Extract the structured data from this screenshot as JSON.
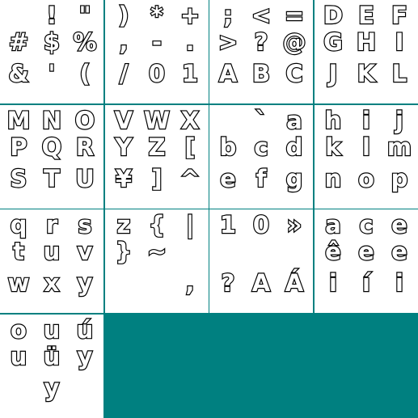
{
  "background_color": "#008080",
  "tile_color": "#ffffff",
  "glyph_fill": "#ffffff",
  "glyph_outline": "#000000",
  "tiles": [
    {
      "glyphs": [
        "!",
        "\"",
        "#",
        "$",
        "%",
        "&",
        "'",
        "("
      ]
    },
    {
      "glyphs": [
        ")",
        "*",
        "+",
        ",",
        "-",
        ".",
        "/",
        "0",
        "1"
      ]
    },
    {
      "glyphs": [
        ";",
        "<",
        "=",
        ">",
        "?",
        "@",
        "A",
        "B",
        "C"
      ]
    },
    {
      "glyphs": [
        "D",
        "E",
        "F",
        "G",
        "H",
        "I",
        "J",
        "K",
        "L"
      ]
    },
    {
      "glyphs": [
        "M",
        "N",
        "O",
        "P",
        "Q",
        "R",
        "S",
        "T",
        "U"
      ]
    },
    {
      "glyphs": [
        "V",
        "W",
        "X",
        "Y",
        "Z",
        "[",
        "¥",
        "]",
        "^"
      ]
    },
    {
      "glyphs": [
        "`",
        "a",
        "b",
        "c",
        "d",
        "e",
        "f",
        "g"
      ]
    },
    {
      "glyphs": [
        "h",
        "i",
        "j",
        "k",
        "l",
        "m",
        "n",
        "o",
        "p"
      ]
    },
    {
      "glyphs": [
        "q",
        "r",
        "s",
        "t",
        "u",
        "v",
        "w",
        "x",
        "y"
      ]
    },
    {
      "glyphs": [
        "z",
        "{",
        "|",
        "}",
        "~",
        ","
      ]
    },
    {
      "glyphs": [
        "1",
        "0",
        "»",
        "?",
        "A",
        "Á"
      ]
    },
    {
      "glyphs": [
        "a",
        "c",
        "e",
        "ê",
        "e",
        "e",
        "i",
        "í",
        "i"
      ]
    },
    {
      "glyphs": [
        "o",
        "u",
        "ú",
        "u",
        "ü",
        "y",
        "y"
      ]
    }
  ]
}
